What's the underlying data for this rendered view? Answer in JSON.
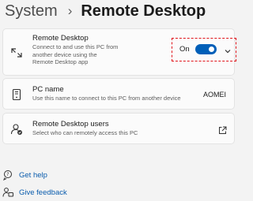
{
  "breadcrumb": {
    "parent": "System",
    "separator": "›",
    "current": "Remote Desktop"
  },
  "remote_desktop": {
    "title": "Remote Desktop",
    "description": "Connect to and use this PC from another device using the Remote Desktop app",
    "toggle_label": "On",
    "toggle_state": true
  },
  "pc_name": {
    "title": "PC name",
    "description": "Use this name to connect to this PC from another device",
    "value": "AOMEI"
  },
  "remote_users": {
    "title": "Remote Desktop users",
    "description": "Select who can remotely access this PC"
  },
  "links": {
    "help": "Get help",
    "feedback": "Give feedback"
  },
  "colors": {
    "accent": "#005fb8",
    "link": "#0a5cad",
    "highlight_border": "#e0141b"
  }
}
